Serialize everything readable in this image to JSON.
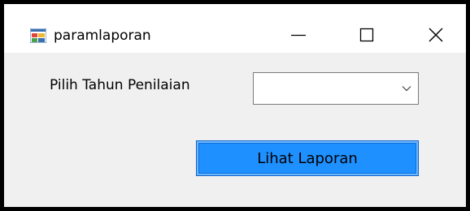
{
  "window": {
    "title": "paramlaporan",
    "app_icon": "windows-form-icon",
    "controls": {
      "minimize_icon": "minimize-icon",
      "maximize_icon": "maximize-icon",
      "close_icon": "close-icon"
    }
  },
  "form": {
    "year_label": "Pilih Tahun Penilaian",
    "year_select": {
      "value": "",
      "icon": "chevron-down-icon"
    },
    "submit_label": "Lihat Laporan"
  },
  "colors": {
    "frame": "#000000",
    "titlebar": "#ffffff",
    "background": "#f0f0f0",
    "button": "#1e90ff"
  }
}
